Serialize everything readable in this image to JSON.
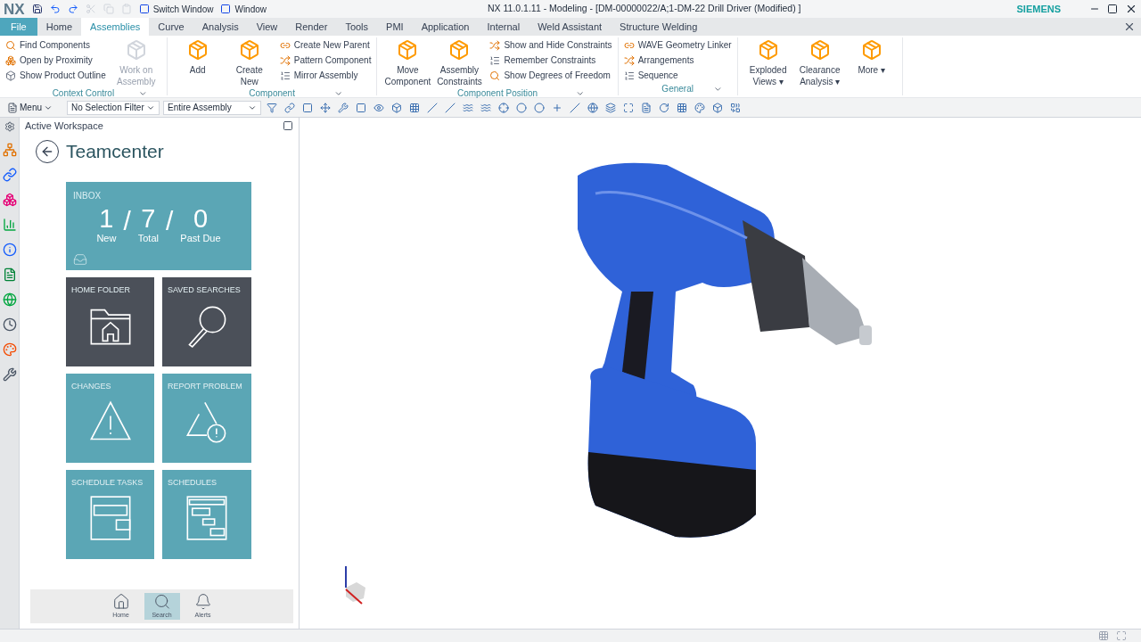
{
  "titlebar": {
    "app": "NX",
    "quick_items": [
      "Switch Window",
      "Window"
    ],
    "title": "NX 11.0.1.11 - Modeling - [DM-00000022/A;1-DM-22 Drill Driver (Modified) ]",
    "brand": "SIEMENS"
  },
  "tabs": [
    {
      "label": "File",
      "kind": "file",
      "selected": false
    },
    {
      "label": "Home",
      "kind": "tab",
      "selected": false
    },
    {
      "label": "Assemblies",
      "kind": "tab",
      "selected": true
    },
    {
      "label": "Curve",
      "kind": "tab",
      "selected": false
    },
    {
      "label": "Analysis",
      "kind": "tab",
      "selected": false
    },
    {
      "label": "View",
      "kind": "tab",
      "selected": false
    },
    {
      "label": "Render",
      "kind": "tab",
      "selected": false
    },
    {
      "label": "Tools",
      "kind": "tab",
      "selected": false
    },
    {
      "label": "PMI",
      "kind": "tab",
      "selected": false
    },
    {
      "label": "Application",
      "kind": "tab",
      "selected": false
    },
    {
      "label": "Internal",
      "kind": "tab",
      "selected": false
    },
    {
      "label": "Weld Assistant",
      "kind": "tab",
      "selected": false
    },
    {
      "label": "Structure Welding",
      "kind": "tab",
      "selected": false
    }
  ],
  "ribbon_groups": [
    {
      "label": "Context Control",
      "items": [
        {
          "kind": "small",
          "label": "Find Components",
          "disabled": false
        },
        {
          "kind": "small",
          "label": "Open by Proximity",
          "disabled": false
        },
        {
          "kind": "small",
          "label": "Show Product Outline",
          "disabled": false
        },
        {
          "kind": "large",
          "label": "Work on Assembly",
          "disabled": true
        }
      ]
    },
    {
      "label": "Component",
      "items": [
        {
          "kind": "large",
          "label": "Add",
          "disabled": false
        },
        {
          "kind": "large",
          "label": "Create New",
          "disabled": false
        },
        {
          "kind": "small",
          "label": "Create New Parent",
          "disabled": false
        },
        {
          "kind": "small",
          "label": "Pattern Component",
          "disabled": false
        },
        {
          "kind": "small",
          "label": "Mirror Assembly",
          "disabled": false
        }
      ]
    },
    {
      "label": "Component Position",
      "items": [
        {
          "kind": "large",
          "label": "Move Component",
          "disabled": false
        },
        {
          "kind": "large",
          "label": "Assembly Constraints",
          "disabled": false
        },
        {
          "kind": "small",
          "label": "Show and Hide Constraints",
          "disabled": false
        },
        {
          "kind": "small",
          "label": "Remember Constraints",
          "disabled": false
        },
        {
          "kind": "small",
          "label": "Show Degrees of Freedom",
          "disabled": false
        }
      ]
    },
    {
      "label": "General",
      "items": [
        {
          "kind": "small",
          "label": "WAVE Geometry Linker",
          "disabled": false
        },
        {
          "kind": "small",
          "label": "Arrangements",
          "disabled": false
        },
        {
          "kind": "small",
          "label": "Sequence",
          "disabled": false
        }
      ]
    },
    {
      "items": [
        {
          "kind": "large",
          "label": "Exploded Views ▾",
          "disabled": false
        },
        {
          "kind": "large",
          "label": "Clearance Analysis ▾",
          "disabled": false
        },
        {
          "kind": "large",
          "label": "More ▾",
          "disabled": false
        }
      ]
    }
  ],
  "toolbar": {
    "menu": "Menu",
    "selection_filter": "No Selection Filter",
    "scope": "Entire Assembly"
  },
  "panel": {
    "header": "Active Workspace",
    "title": "Teamcenter",
    "inbox": {
      "label": "INBOX",
      "separator": "/",
      "counts": [
        {
          "value": "1",
          "caption": "New"
        },
        {
          "value": "7",
          "caption": "Total"
        },
        {
          "value": "0",
          "caption": "Past Due"
        }
      ]
    },
    "tiles": [
      {
        "label": "HOME FOLDER",
        "kind": "folder",
        "color": "#4b5059"
      },
      {
        "label": "SAVED SEARCHES",
        "kind": "search",
        "color": "#4b5059"
      },
      {
        "label": "CHANGES",
        "kind": "warning",
        "color": "#5ba6b5"
      },
      {
        "label": "REPORT PROBLEM",
        "kind": "problem",
        "color": "#5ba6b5"
      },
      {
        "label": "SCHEDULE TASKS",
        "kind": "tasks",
        "color": "#5ba6b5"
      },
      {
        "label": "SCHEDULES",
        "kind": "schedules",
        "color": "#5ba6b5"
      }
    ],
    "nav": [
      {
        "label": "Home",
        "kind": "home",
        "selected": false
      },
      {
        "label": "Search",
        "kind": "search",
        "selected": true
      },
      {
        "label": "Alerts",
        "kind": "alerts",
        "selected": false
      }
    ]
  }
}
